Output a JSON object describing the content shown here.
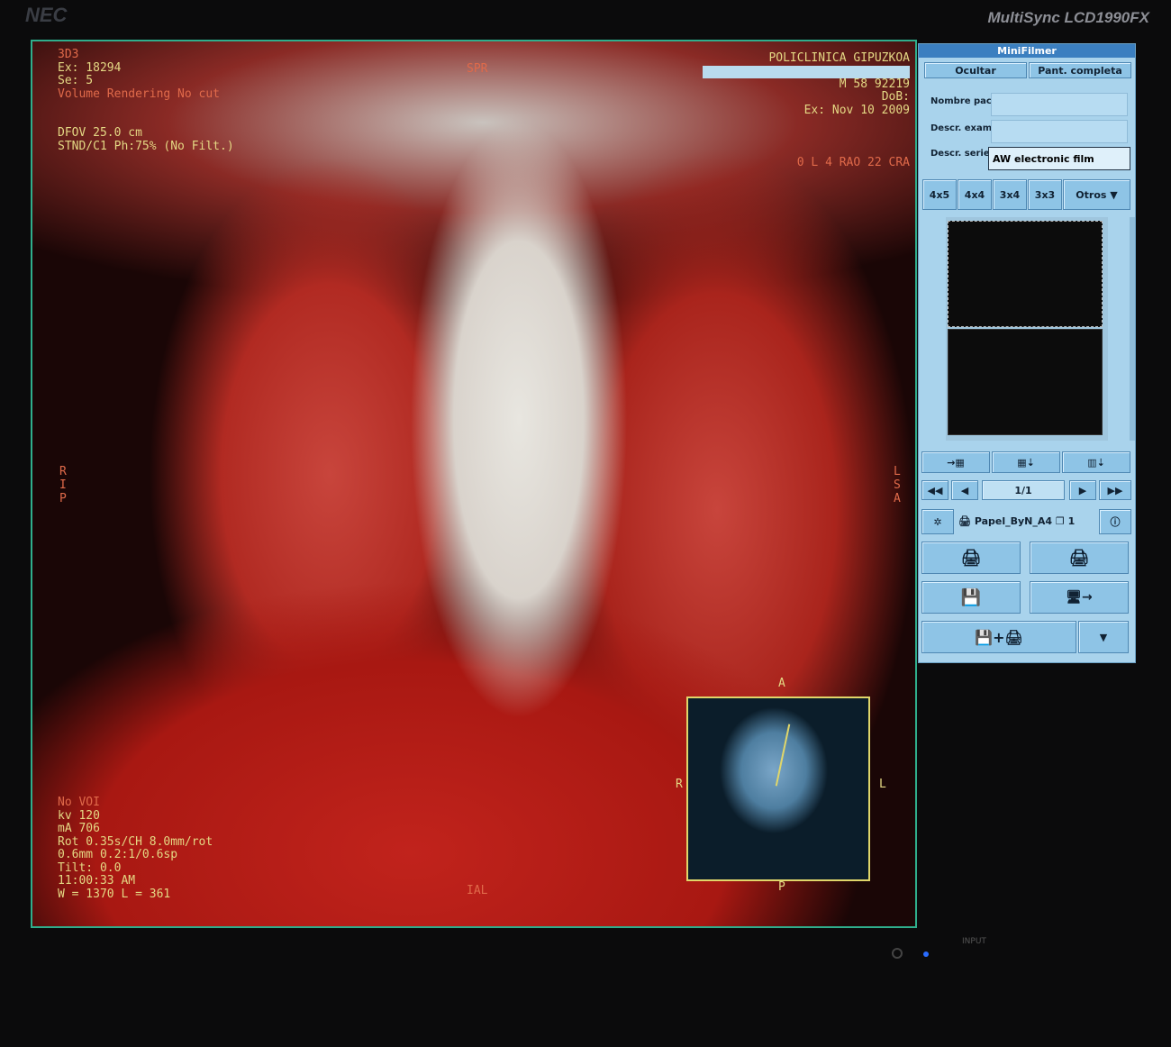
{
  "monitor": {
    "brand": "NEC",
    "model": "MultiSync LCD1990FX",
    "input_label": "INPUT"
  },
  "viewer": {
    "top_left": {
      "series_id": "3D3",
      "exam": "Ex: 18294",
      "series": "Se: 5",
      "mode": "Volume Rendering  No cut",
      "dfov": "DFOV 25.0 cm",
      "recon": "STND/C1 Ph:75% (No Filt.)"
    },
    "top_right": {
      "institution": "POLICLINICA GIPUZKOA",
      "patient": "M 58  92219",
      "dob": "DoB:",
      "exam_date": "Ex: Nov 10 2009",
      "angle": "0 L 4 RAO 22 CRA"
    },
    "bottom_left": {
      "voi": "No VOI",
      "kv": "kv 120",
      "ma": "mA 706",
      "rot": "Rot 0.35s/CH 8.0mm/rot",
      "slice": "0.6mm 0.2:1/0.6sp",
      "tilt": "Tilt: 0.0",
      "time": "11:00:33 AM",
      "window": "W = 1370 L = 361"
    },
    "orientation": {
      "top": "SPR",
      "bottom": "IAL",
      "left": "R\nI\nP",
      "right": "L\nS\nA"
    },
    "inset": {
      "top": "A",
      "bottom": "P",
      "left": "R",
      "right": "L"
    }
  },
  "minifilmer": {
    "title": "MiniFilmer",
    "hide": "Ocultar",
    "fullscreen": "Pant. completa",
    "patient_name_label": "Nombre pacie.",
    "patient_name": "",
    "exam_desc_label": "Descr. examen",
    "exam_desc": "",
    "series_desc_label": "Descr. serie",
    "series_desc": "AW electronic film",
    "layouts": [
      "4x5",
      "4x4",
      "3x4",
      "3x3"
    ],
    "more": "Otros ▼",
    "page": "1/1",
    "printer": "Papel_ByN_A4",
    "copies": "1",
    "colors": {
      "panel": "#a9d3ec",
      "button": "#8ec4e6",
      "title_bar": "#3b7fc0"
    }
  }
}
